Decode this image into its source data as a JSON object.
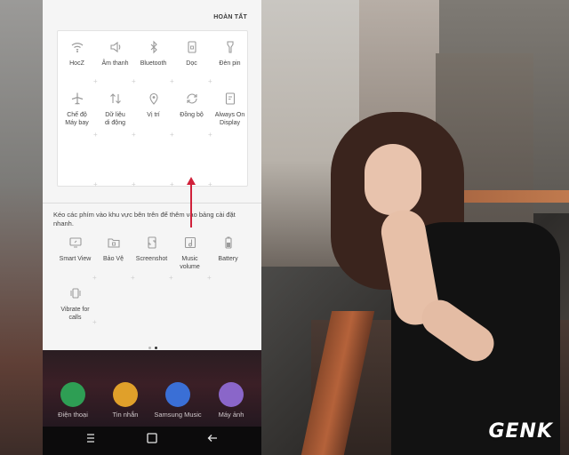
{
  "panel": {
    "done_label": "HOÀN TẤT",
    "active_tiles": [
      {
        "label": "HocZ",
        "icon": "wifi-icon"
      },
      {
        "label": "Âm thanh",
        "icon": "sound-icon"
      },
      {
        "label": "Bluetooth",
        "icon": "bluetooth-icon"
      },
      {
        "label": "Dọc",
        "icon": "portrait-lock-icon"
      },
      {
        "label": "Đèn pin",
        "icon": "flashlight-icon"
      },
      {
        "label": "Chế độ\nMáy bay",
        "icon": "airplane-icon"
      },
      {
        "label": "Dữ liệu\ndi động",
        "icon": "mobile-data-icon"
      },
      {
        "label": "Vị trí",
        "icon": "location-icon"
      },
      {
        "label": "Đồng bộ",
        "icon": "sync-icon"
      },
      {
        "label": "Always On\nDisplay",
        "icon": "always-on-display-icon"
      }
    ],
    "hint": "Kéo các phím vào khu vực bên trên để thêm vào bảng cài đặt nhanh.",
    "available_tiles": [
      {
        "label": "Smart View",
        "icon": "smart-view-icon"
      },
      {
        "label": "Bảo Vệ",
        "icon": "secure-folder-icon"
      },
      {
        "label": "Screenshot",
        "icon": "screenshot-icon"
      },
      {
        "label": "Music\nvolume",
        "icon": "music-volume-icon"
      },
      {
        "label": "Battery",
        "icon": "battery-icon"
      },
      {
        "label": "Vibrate for\ncalls",
        "icon": "vibrate-icon"
      }
    ],
    "accent": "#d0213a"
  },
  "dock": {
    "apps": [
      {
        "label": "Điện thoại",
        "icon": "phone-icon",
        "color": "#2e9e54"
      },
      {
        "label": "Tin nhắn",
        "icon": "messages-icon",
        "color": "#e0a02a"
      },
      {
        "label": "Samsung Music",
        "icon": "music-icon",
        "color": "#3a6fd6"
      },
      {
        "label": "Máy ảnh",
        "icon": "camera-icon",
        "color": "#8a66c9"
      }
    ]
  },
  "navbar": {
    "recents_icon": "recents-icon",
    "home_icon": "home-icon",
    "back_icon": "back-icon"
  },
  "watermark": "GENK"
}
